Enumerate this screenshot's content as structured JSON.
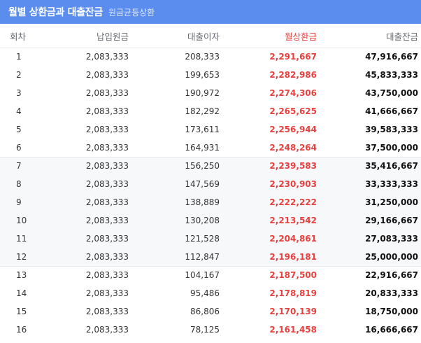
{
  "header": {
    "title": "월별 상환금과 대출잔금",
    "subtitle": "원금균등상환"
  },
  "columns": [
    "회차",
    "납입원금",
    "대출이자",
    "월상환금",
    "대출잔금"
  ],
  "colors": {
    "header_bg": "#5b8def",
    "monthly_payment": "#e8403f",
    "shaded_row_bg": "#f7f8fa"
  },
  "rows": [
    {
      "no": "1",
      "principal": "2,083,333",
      "interest": "208,333",
      "payment": "2,291,667",
      "balance": "47,916,667"
    },
    {
      "no": "2",
      "principal": "2,083,333",
      "interest": "199,653",
      "payment": "2,282,986",
      "balance": "45,833,333"
    },
    {
      "no": "3",
      "principal": "2,083,333",
      "interest": "190,972",
      "payment": "2,274,306",
      "balance": "43,750,000"
    },
    {
      "no": "4",
      "principal": "2,083,333",
      "interest": "182,292",
      "payment": "2,265,625",
      "balance": "41,666,667"
    },
    {
      "no": "5",
      "principal": "2,083,333",
      "interest": "173,611",
      "payment": "2,256,944",
      "balance": "39,583,333"
    },
    {
      "no": "6",
      "principal": "2,083,333",
      "interest": "164,931",
      "payment": "2,248,264",
      "balance": "37,500,000"
    },
    {
      "no": "7",
      "principal": "2,083,333",
      "interest": "156,250",
      "payment": "2,239,583",
      "balance": "35,416,667"
    },
    {
      "no": "8",
      "principal": "2,083,333",
      "interest": "147,569",
      "payment": "2,230,903",
      "balance": "33,333,333"
    },
    {
      "no": "9",
      "principal": "2,083,333",
      "interest": "138,889",
      "payment": "2,222,222",
      "balance": "31,250,000"
    },
    {
      "no": "10",
      "principal": "2,083,333",
      "interest": "130,208",
      "payment": "2,213,542",
      "balance": "29,166,667"
    },
    {
      "no": "11",
      "principal": "2,083,333",
      "interest": "121,528",
      "payment": "2,204,861",
      "balance": "27,083,333"
    },
    {
      "no": "12",
      "principal": "2,083,333",
      "interest": "112,847",
      "payment": "2,196,181",
      "balance": "25,000,000"
    },
    {
      "no": "13",
      "principal": "2,083,333",
      "interest": "104,167",
      "payment": "2,187,500",
      "balance": "22,916,667"
    },
    {
      "no": "14",
      "principal": "2,083,333",
      "interest": "95,486",
      "payment": "2,178,819",
      "balance": "20,833,333"
    },
    {
      "no": "15",
      "principal": "2,083,333",
      "interest": "86,806",
      "payment": "2,170,139",
      "balance": "18,750,000"
    },
    {
      "no": "16",
      "principal": "2,083,333",
      "interest": "78,125",
      "payment": "2,161,458",
      "balance": "16,666,667"
    }
  ]
}
